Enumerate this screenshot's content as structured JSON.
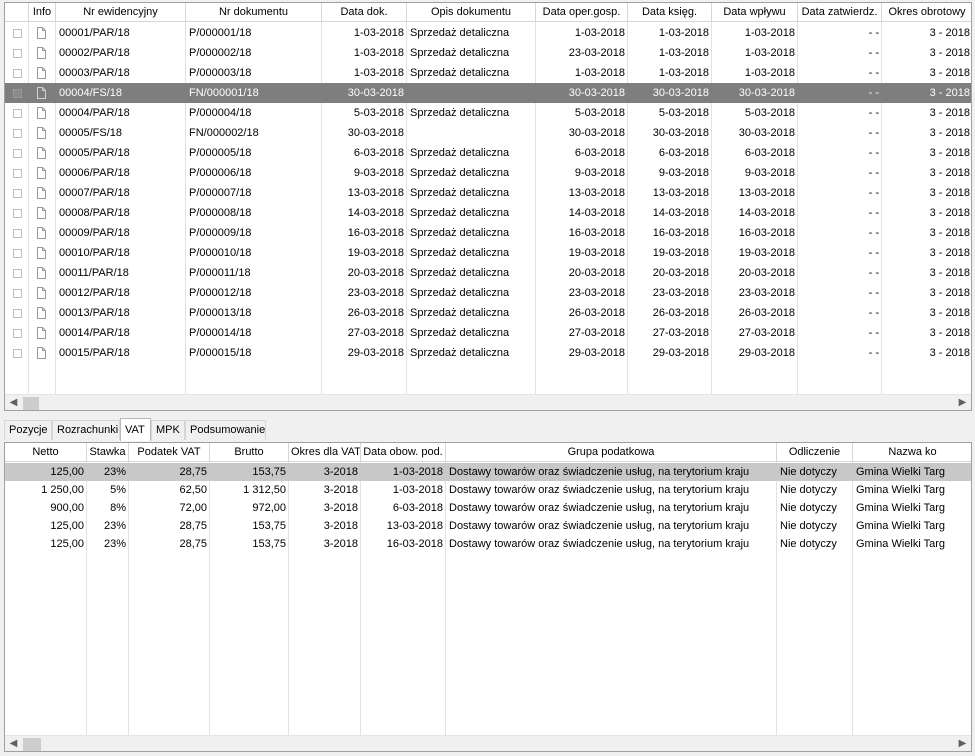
{
  "top_grid": {
    "columns": [
      {
        "key": "chk",
        "label": ""
      },
      {
        "key": "info",
        "label": "Info"
      },
      {
        "key": "nr_ew",
        "label": "Nr ewidencyjny"
      },
      {
        "key": "nr_dok",
        "label": "Nr dokumentu"
      },
      {
        "key": "data_dok",
        "label": "Data dok."
      },
      {
        "key": "opis",
        "label": "Opis dokumentu"
      },
      {
        "key": "data_oper",
        "label": "Data oper.gosp."
      },
      {
        "key": "data_ksieg",
        "label": "Data księg."
      },
      {
        "key": "data_wplywu",
        "label": "Data wpływu"
      },
      {
        "key": "data_zatw",
        "label": "Data zatwierdz."
      },
      {
        "key": "okres",
        "label": "Okres obrotowy"
      }
    ],
    "selected_row": 3,
    "rows": [
      {
        "nr_ew": "00001/PAR/18",
        "nr_dok": "P/000001/18",
        "data_dok": "1-03-2018",
        "opis": "Sprzedaż detaliczna",
        "data_oper": "1-03-2018",
        "data_ksieg": "1-03-2018",
        "data_wplywu": "1-03-2018",
        "data_zatw": "- -",
        "okres": "3 - 2018"
      },
      {
        "nr_ew": "00002/PAR/18",
        "nr_dok": "P/000002/18",
        "data_dok": "1-03-2018",
        "opis": "Sprzedaż detaliczna",
        "data_oper": "23-03-2018",
        "data_ksieg": "1-03-2018",
        "data_wplywu": "1-03-2018",
        "data_zatw": "- -",
        "okres": "3 - 2018"
      },
      {
        "nr_ew": "00003/PAR/18",
        "nr_dok": "P/000003/18",
        "data_dok": "1-03-2018",
        "opis": "Sprzedaż detaliczna",
        "data_oper": "1-03-2018",
        "data_ksieg": "1-03-2018",
        "data_wplywu": "1-03-2018",
        "data_zatw": "- -",
        "okres": "3 - 2018"
      },
      {
        "nr_ew": "00004/FS/18",
        "nr_dok": "FN/000001/18",
        "data_dok": "30-03-2018",
        "opis": "",
        "data_oper": "30-03-2018",
        "data_ksieg": "30-03-2018",
        "data_wplywu": "30-03-2018",
        "data_zatw": "- -",
        "okres": "3 - 2018"
      },
      {
        "nr_ew": "00004/PAR/18",
        "nr_dok": "P/000004/18",
        "data_dok": "5-03-2018",
        "opis": "Sprzedaż detaliczna",
        "data_oper": "5-03-2018",
        "data_ksieg": "5-03-2018",
        "data_wplywu": "5-03-2018",
        "data_zatw": "- -",
        "okres": "3 - 2018"
      },
      {
        "nr_ew": "00005/FS/18",
        "nr_dok": "FN/000002/18",
        "data_dok": "30-03-2018",
        "opis": "",
        "data_oper": "30-03-2018",
        "data_ksieg": "30-03-2018",
        "data_wplywu": "30-03-2018",
        "data_zatw": "- -",
        "okres": "3 - 2018"
      },
      {
        "nr_ew": "00005/PAR/18",
        "nr_dok": "P/000005/18",
        "data_dok": "6-03-2018",
        "opis": "Sprzedaż detaliczna",
        "data_oper": "6-03-2018",
        "data_ksieg": "6-03-2018",
        "data_wplywu": "6-03-2018",
        "data_zatw": "- -",
        "okres": "3 - 2018"
      },
      {
        "nr_ew": "00006/PAR/18",
        "nr_dok": "P/000006/18",
        "data_dok": "9-03-2018",
        "opis": "Sprzedaż detaliczna",
        "data_oper": "9-03-2018",
        "data_ksieg": "9-03-2018",
        "data_wplywu": "9-03-2018",
        "data_zatw": "- -",
        "okres": "3 - 2018"
      },
      {
        "nr_ew": "00007/PAR/18",
        "nr_dok": "P/000007/18",
        "data_dok": "13-03-2018",
        "opis": "Sprzedaż detaliczna",
        "data_oper": "13-03-2018",
        "data_ksieg": "13-03-2018",
        "data_wplywu": "13-03-2018",
        "data_zatw": "- -",
        "okres": "3 - 2018"
      },
      {
        "nr_ew": "00008/PAR/18",
        "nr_dok": "P/000008/18",
        "data_dok": "14-03-2018",
        "opis": "Sprzedaż detaliczna",
        "data_oper": "14-03-2018",
        "data_ksieg": "14-03-2018",
        "data_wplywu": "14-03-2018",
        "data_zatw": "- -",
        "okres": "3 - 2018"
      },
      {
        "nr_ew": "00009/PAR/18",
        "nr_dok": "P/000009/18",
        "data_dok": "16-03-2018",
        "opis": "Sprzedaż detaliczna",
        "data_oper": "16-03-2018",
        "data_ksieg": "16-03-2018",
        "data_wplywu": "16-03-2018",
        "data_zatw": "- -",
        "okres": "3 - 2018"
      },
      {
        "nr_ew": "00010/PAR/18",
        "nr_dok": "P/000010/18",
        "data_dok": "19-03-2018",
        "opis": "Sprzedaż detaliczna",
        "data_oper": "19-03-2018",
        "data_ksieg": "19-03-2018",
        "data_wplywu": "19-03-2018",
        "data_zatw": "- -",
        "okres": "3 - 2018"
      },
      {
        "nr_ew": "00011/PAR/18",
        "nr_dok": "P/000011/18",
        "data_dok": "20-03-2018",
        "opis": "Sprzedaż detaliczna",
        "data_oper": "20-03-2018",
        "data_ksieg": "20-03-2018",
        "data_wplywu": "20-03-2018",
        "data_zatw": "- -",
        "okres": "3 - 2018"
      },
      {
        "nr_ew": "00012/PAR/18",
        "nr_dok": "P/000012/18",
        "data_dok": "23-03-2018",
        "opis": "Sprzedaż detaliczna",
        "data_oper": "23-03-2018",
        "data_ksieg": "23-03-2018",
        "data_wplywu": "23-03-2018",
        "data_zatw": "- -",
        "okres": "3 - 2018"
      },
      {
        "nr_ew": "00013/PAR/18",
        "nr_dok": "P/000013/18",
        "data_dok": "26-03-2018",
        "opis": "Sprzedaż detaliczna",
        "data_oper": "26-03-2018",
        "data_ksieg": "26-03-2018",
        "data_wplywu": "26-03-2018",
        "data_zatw": "- -",
        "okres": "3 - 2018"
      },
      {
        "nr_ew": "00014/PAR/18",
        "nr_dok": "P/000014/18",
        "data_dok": "27-03-2018",
        "opis": "Sprzedaż detaliczna",
        "data_oper": "27-03-2018",
        "data_ksieg": "27-03-2018",
        "data_wplywu": "27-03-2018",
        "data_zatw": "- -",
        "okres": "3 - 2018"
      },
      {
        "nr_ew": "00015/PAR/18",
        "nr_dok": "P/000015/18",
        "data_dok": "29-03-2018",
        "opis": "Sprzedaż detaliczna",
        "data_oper": "29-03-2018",
        "data_ksieg": "29-03-2018",
        "data_wplywu": "29-03-2018",
        "data_zatw": "- -",
        "okres": "3 - 2018"
      }
    ]
  },
  "tabs": [
    {
      "label": "Pozycje",
      "active": false
    },
    {
      "label": "Rozrachunki",
      "active": false
    },
    {
      "label": "VAT",
      "active": true
    },
    {
      "label": "MPK",
      "active": false
    },
    {
      "label": "Podsumowanie",
      "active": false
    }
  ],
  "vat_grid": {
    "columns": [
      {
        "key": "netto",
        "label": "Netto"
      },
      {
        "key": "stawka",
        "label": "Stawka"
      },
      {
        "key": "podatek",
        "label": "Podatek VAT"
      },
      {
        "key": "brutto",
        "label": "Brutto"
      },
      {
        "key": "okres_vat",
        "label": "Okres dla VAT"
      },
      {
        "key": "data_obow",
        "label": "Data obow. pod."
      },
      {
        "key": "grupa",
        "label": "Grupa podatkowa"
      },
      {
        "key": "odliczenie",
        "label": "Odliczenie"
      },
      {
        "key": "nazwa",
        "label": "Nazwa ko"
      }
    ],
    "selected_row": 0,
    "rows": [
      {
        "netto": "125,00",
        "stawka": "23%",
        "podatek": "28,75",
        "brutto": "153,75",
        "okres_vat": "3-2018",
        "data_obow": "1-03-2018",
        "grupa": "Dostawy towarów oraz świadczenie usług, na terytorium kraju",
        "odliczenie": "Nie dotyczy",
        "nazwa": "Gmina Wielki Targ"
      },
      {
        "netto": "1 250,00",
        "stawka": "5%",
        "podatek": "62,50",
        "brutto": "1 312,50",
        "okres_vat": "3-2018",
        "data_obow": "1-03-2018",
        "grupa": "Dostawy towarów oraz świadczenie usług, na terytorium kraju",
        "odliczenie": "Nie dotyczy",
        "nazwa": "Gmina Wielki Targ"
      },
      {
        "netto": "900,00",
        "stawka": "8%",
        "podatek": "72,00",
        "brutto": "972,00",
        "okres_vat": "3-2018",
        "data_obow": "6-03-2018",
        "grupa": "Dostawy towarów oraz świadczenie usług, na terytorium kraju",
        "odliczenie": "Nie dotyczy",
        "nazwa": "Gmina Wielki Targ"
      },
      {
        "netto": "125,00",
        "stawka": "23%",
        "podatek": "28,75",
        "brutto": "153,75",
        "okres_vat": "3-2018",
        "data_obow": "13-03-2018",
        "grupa": "Dostawy towarów oraz świadczenie usług, na terytorium kraju",
        "odliczenie": "Nie dotyczy",
        "nazwa": "Gmina Wielki Targ"
      },
      {
        "netto": "125,00",
        "stawka": "23%",
        "podatek": "28,75",
        "brutto": "153,75",
        "okres_vat": "3-2018",
        "data_obow": "16-03-2018",
        "grupa": "Dostawy towarów oraz świadczenie usług, na terytorium kraju",
        "odliczenie": "Nie dotyczy",
        "nazwa": "Gmina Wielki Targ"
      }
    ]
  },
  "icons": {
    "row_checkbox": "checkbox-icon",
    "row_info": "document-icon",
    "scroll_left": "chevron-left-icon",
    "scroll_right": "chevron-right-icon"
  }
}
